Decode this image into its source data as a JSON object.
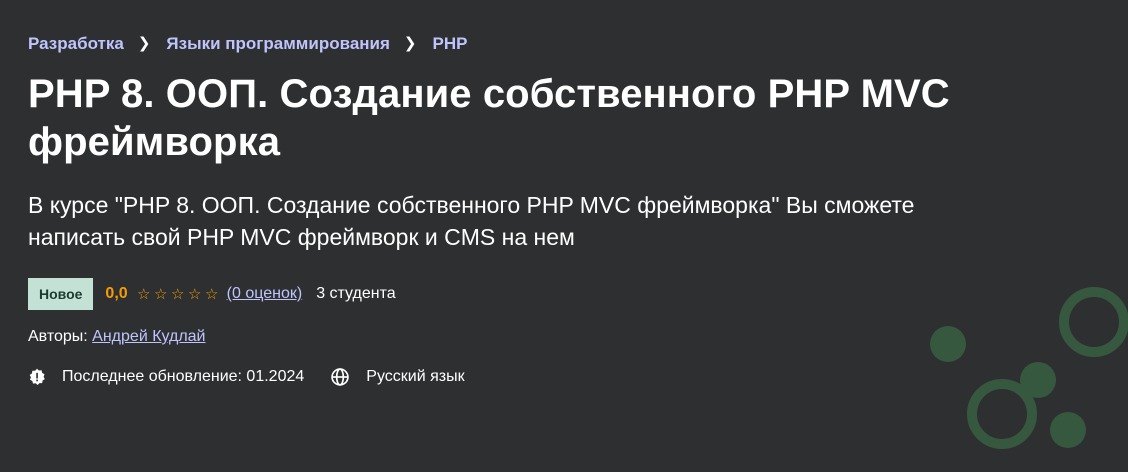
{
  "breadcrumb": {
    "items": [
      "Разработка",
      "Языки программирования",
      "PHP"
    ]
  },
  "course": {
    "title": "PHP 8. ООП. Создание собственного PHP MVC фреймворка",
    "subtitle": "В курсе \"PHP 8. ООП. Создание собственного PHP MVC фреймворка\" Вы сможете написать свой PHP MVC фреймворк и CMS на нем",
    "badge": "Новое",
    "rating": "0,0",
    "rating_value": 0,
    "rating_max": 5,
    "ratings_count_text": "(0 оценок)",
    "students_text": "3 студента",
    "authors_label": "Авторы:",
    "author_name": "Андрей Кудлай",
    "last_update_label": "Последнее обновление: 01.2024",
    "language": "Русский язык"
  },
  "icons": {
    "update": "alert-badge-icon",
    "language": "globe-icon",
    "star": "star-outline-icon",
    "breadcrumb_separator": "chevron-right-icon"
  },
  "colors": {
    "background": "#2d2f31",
    "link": "#c0c4fc",
    "rating": "#f69c08",
    "badge_bg": "#c4e1d5",
    "badge_text": "#1d3b2f"
  }
}
